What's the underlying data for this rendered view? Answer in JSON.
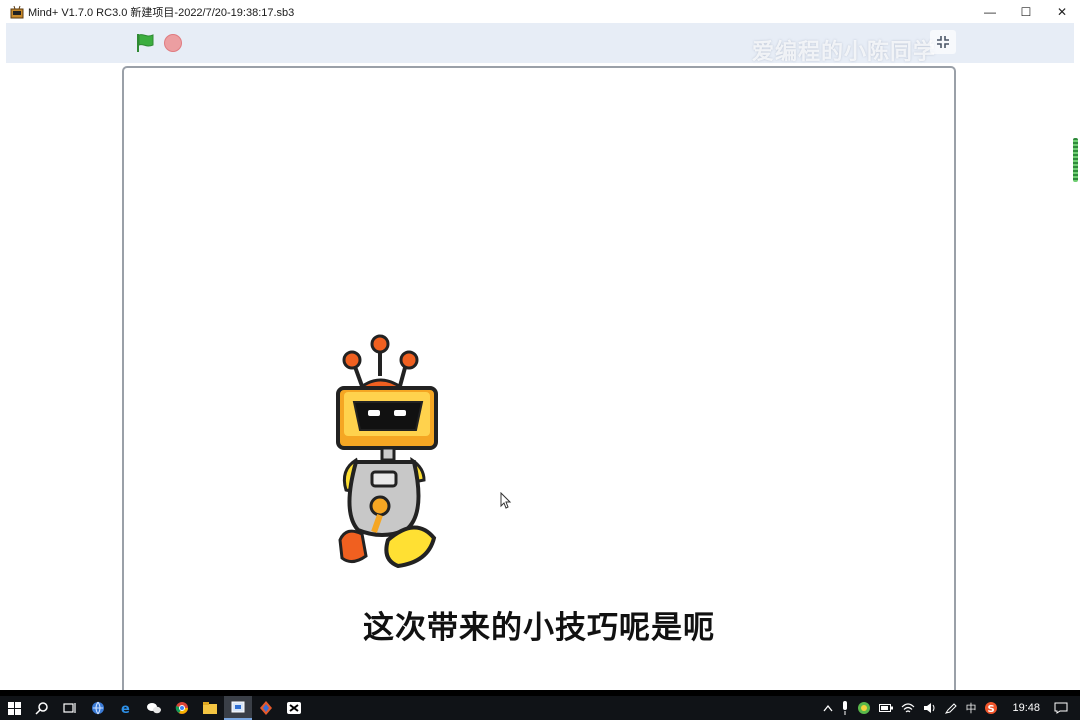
{
  "window": {
    "title": "Mind+ V1.7.0 RC3.0   新建项目-2022/7/20-19:38:17.sb3",
    "minimize": "—",
    "maximize": "☐",
    "close": "✕"
  },
  "stage_toolbar": {
    "watermark": "爱编程的小陈同学"
  },
  "stage": {
    "subtitle": "这次带来的小技巧呢是呃"
  },
  "taskbar": {
    "items": [
      "start-icon",
      "search-icon",
      "task-view-icon",
      "browser-icon",
      "edge-icon",
      "wechat-icon",
      "chrome-icon",
      "file-explorer-icon",
      "mindplus-icon",
      "app-icon",
      "capcut-icon"
    ],
    "tray": {
      "ime": "中",
      "time": "19:48"
    }
  },
  "colors": {
    "toolbar_bg": "#e7edf6",
    "flag_green": "#3cae3f",
    "stop_red": "#ec9ea1",
    "taskbar_bg": "#101317",
    "robot_orange": "#f5a623",
    "robot_yellow": "#ffe033"
  }
}
